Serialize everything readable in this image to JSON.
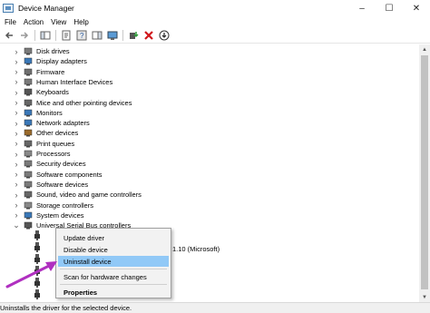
{
  "window": {
    "title": "Device Manager",
    "controls": [
      "–",
      "☐",
      "✕"
    ]
  },
  "menu": [
    "File",
    "Action",
    "View",
    "Help"
  ],
  "tree": [
    {
      "label": "Disk drives",
      "icon": "disk-drive-icon",
      "expanded": false
    },
    {
      "label": "Display adapters",
      "icon": "display-adapter-icon",
      "expanded": false
    },
    {
      "label": "Firmware",
      "icon": "firmware-icon",
      "expanded": false
    },
    {
      "label": "Human Interface Devices",
      "icon": "hid-icon",
      "expanded": false
    },
    {
      "label": "Keyboards",
      "icon": "keyboard-icon",
      "expanded": false
    },
    {
      "label": "Mice and other pointing devices",
      "icon": "mouse-icon",
      "expanded": false
    },
    {
      "label": "Monitors",
      "icon": "monitor-icon",
      "expanded": false
    },
    {
      "label": "Network adapters",
      "icon": "network-adapter-icon",
      "expanded": false
    },
    {
      "label": "Other devices",
      "icon": "other-devices-icon",
      "expanded": false
    },
    {
      "label": "Print queues",
      "icon": "printer-icon",
      "expanded": false
    },
    {
      "label": "Processors",
      "icon": "processor-icon",
      "expanded": false
    },
    {
      "label": "Security devices",
      "icon": "security-device-icon",
      "expanded": false
    },
    {
      "label": "Software components",
      "icon": "software-component-icon",
      "expanded": false
    },
    {
      "label": "Software devices",
      "icon": "software-device-icon",
      "expanded": false
    },
    {
      "label": "Sound, video and game controllers",
      "icon": "speaker-icon",
      "expanded": false
    },
    {
      "label": "Storage controllers",
      "icon": "storage-controller-icon",
      "expanded": false
    },
    {
      "label": "System devices",
      "icon": "system-device-icon",
      "expanded": false
    },
    {
      "label": "Universal Serial Bus controllers",
      "icon": "usb-icon",
      "expanded": true
    }
  ],
  "usb_partial_text": "1.10 (Microsoft)",
  "context_menu": {
    "items": [
      "Update driver",
      "Disable device",
      "Uninstall device",
      "Scan for hardware changes",
      "Properties"
    ],
    "highlighted": "Uninstall device"
  },
  "status_text": "Uninstalls the driver for the selected device.",
  "colors": {
    "highlight": "#91c9f7",
    "arrow": "#b030c0",
    "icon_blue": "#3a78b8"
  }
}
